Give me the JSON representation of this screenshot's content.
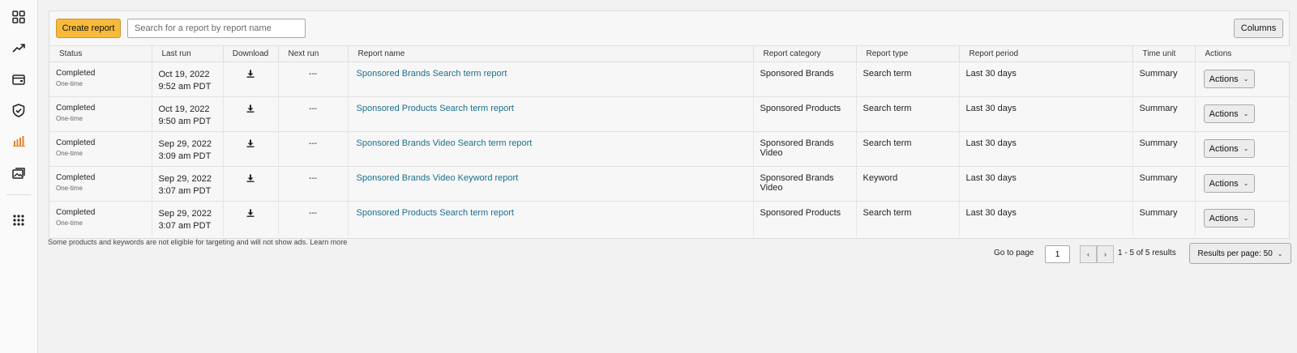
{
  "sidebar": {
    "icons": [
      "dashboard-grid-icon",
      "trending-up-icon",
      "wallet-icon",
      "shield-icon",
      "bar-chart-icon",
      "media-library-icon",
      "apps-grid-icon"
    ],
    "active_color": "#e3822a"
  },
  "toolbar": {
    "create_label": "Create report",
    "search_placeholder": "Search for a report by report name",
    "columns_label": "Columns"
  },
  "table": {
    "headers": {
      "status": "Status",
      "last_run": "Last run",
      "download": "Download",
      "next_run": "Next run",
      "report_name": "Report name",
      "report_category": "Report category",
      "report_type": "Report type",
      "report_period": "Report period",
      "time_unit": "Time unit",
      "actions": "Actions"
    },
    "rows": [
      {
        "status": "Completed",
        "frequency": "One-time",
        "date": "Oct 19, 2022",
        "time": "9:52 am PDT",
        "next_run": "---",
        "name": "Sponsored Brands Search term report",
        "category": "Sponsored Brands",
        "type": "Search term",
        "period": "Last 30 days",
        "time_unit": "Summary",
        "action_label": "Actions"
      },
      {
        "status": "Completed",
        "frequency": "One-time",
        "date": "Oct 19, 2022",
        "time": "9:50 am PDT",
        "next_run": "---",
        "name": "Sponsored Products Search term report",
        "category": "Sponsored Products",
        "type": "Search term",
        "period": "Last 30 days",
        "time_unit": "Summary",
        "action_label": "Actions"
      },
      {
        "status": "Completed",
        "frequency": "One-time",
        "date": "Sep 29, 2022",
        "time": "3:09 am PDT",
        "next_run": "---",
        "name": "Sponsored Brands Video Search term report",
        "category": "Sponsored Brands Video",
        "type": "Search term",
        "period": "Last 30 days",
        "time_unit": "Summary",
        "action_label": "Actions"
      },
      {
        "status": "Completed",
        "frequency": "One-time",
        "date": "Sep 29, 2022",
        "time": "3:07 am PDT",
        "next_run": "---",
        "name": "Sponsored Brands Video Keyword report",
        "category": "Sponsored Brands Video",
        "type": "Keyword",
        "period": "Last 30 days",
        "time_unit": "Summary",
        "action_label": "Actions"
      },
      {
        "status": "Completed",
        "frequency": "One-time",
        "date": "Sep 29, 2022",
        "time": "3:07 am PDT",
        "next_run": "---",
        "name": "Sponsored Products Search term report",
        "category": "Sponsored Products",
        "type": "Search term",
        "period": "Last 30 days",
        "time_unit": "Summary",
        "action_label": "Actions"
      }
    ]
  },
  "footer": {
    "note": "Some products and keywords are not eligible for targeting and will not show ads.",
    "learn_more": "Learn more"
  },
  "pagination": {
    "goto_label": "Go to page",
    "page": "1",
    "prev": "‹",
    "next": "›",
    "count_text": "1 - 5 of 5 results",
    "per_page_label": "Results per page: 50"
  },
  "colors": {
    "primary_button": "#f7ba3a",
    "link": "#1b6f8b"
  }
}
